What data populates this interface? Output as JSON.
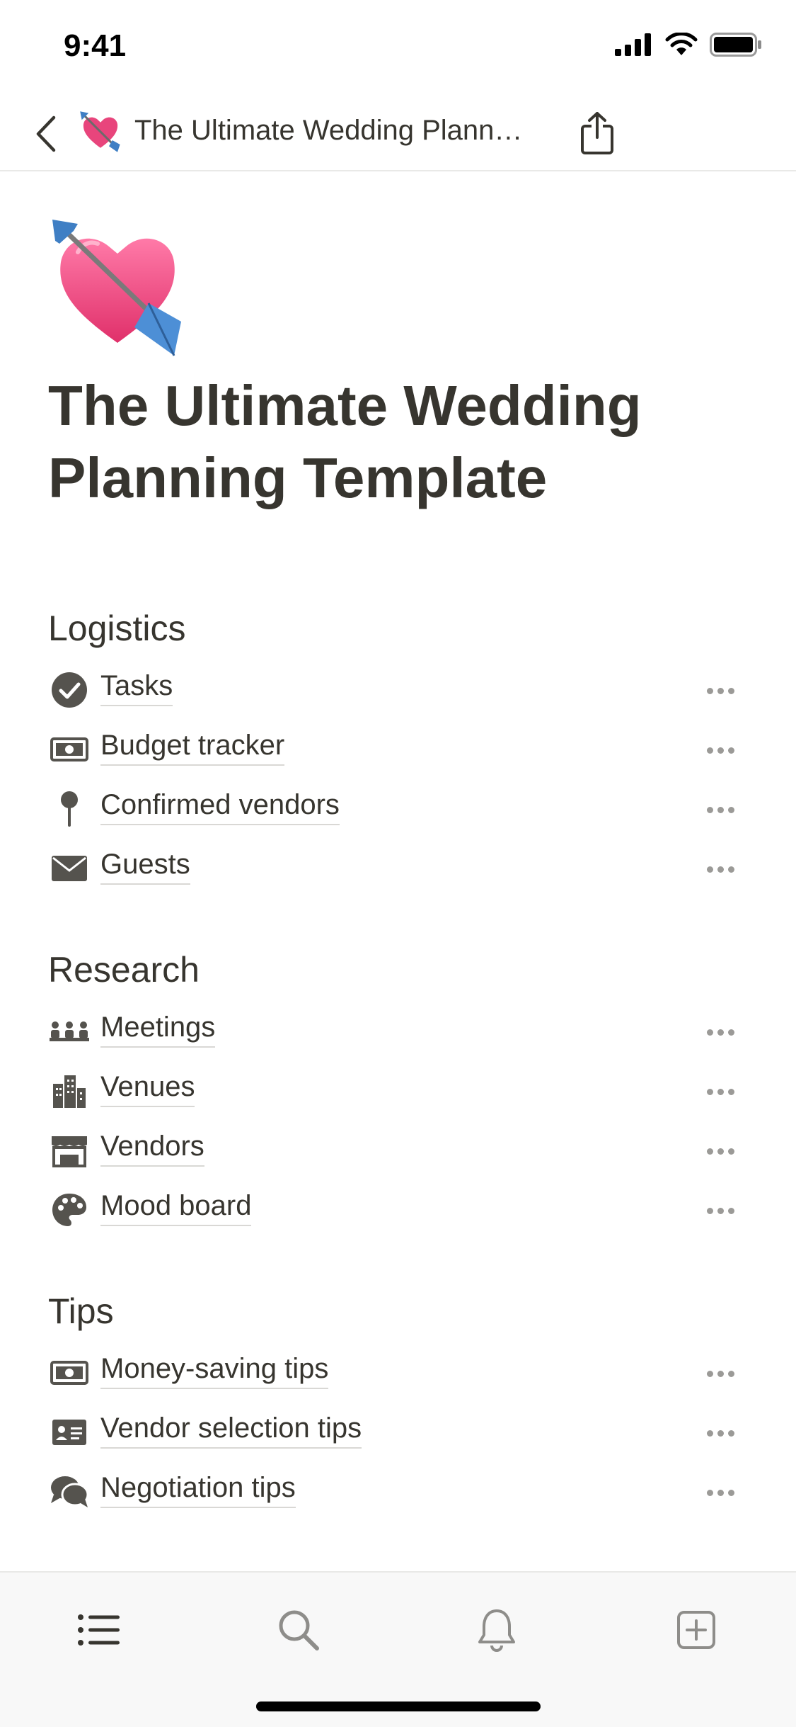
{
  "status_bar": {
    "time": "9:41"
  },
  "nav": {
    "title": "The Ultimate Wedding Plann…",
    "emoji_icon": "heart-with-arrow-icon"
  },
  "page": {
    "title": "The Ultimate Wedding Planning Template",
    "icon": "heart-with-arrow-icon"
  },
  "sections": [
    {
      "heading": "Logistics",
      "items": [
        {
          "label": "Tasks",
          "icon": "check-circle-icon"
        },
        {
          "label": "Budget tracker",
          "icon": "banknote-icon"
        },
        {
          "label": "Confirmed vendors",
          "icon": "pin-icon"
        },
        {
          "label": "Guests",
          "icon": "envelope-icon"
        }
      ]
    },
    {
      "heading": "Research",
      "items": [
        {
          "label": "Meetings",
          "icon": "people-icon"
        },
        {
          "label": "Venues",
          "icon": "buildings-icon"
        },
        {
          "label": "Vendors",
          "icon": "storefront-icon"
        },
        {
          "label": "Mood board",
          "icon": "palette-icon"
        }
      ]
    },
    {
      "heading": "Tips",
      "items": [
        {
          "label": "Money-saving tips",
          "icon": "banknote-icon"
        },
        {
          "label": "Vendor selection tips",
          "icon": "id-card-icon"
        },
        {
          "label": "Negotiation tips",
          "icon": "speech-bubbles-icon"
        }
      ]
    }
  ],
  "toolbar": [
    "list-icon",
    "search-icon",
    "bell-icon",
    "add-page-icon"
  ],
  "colors": {
    "text": "#37352f",
    "icon": "#55534e",
    "muted": "#9b9a97",
    "heart": "#e8457c",
    "arrow": "#3f7fc4"
  }
}
